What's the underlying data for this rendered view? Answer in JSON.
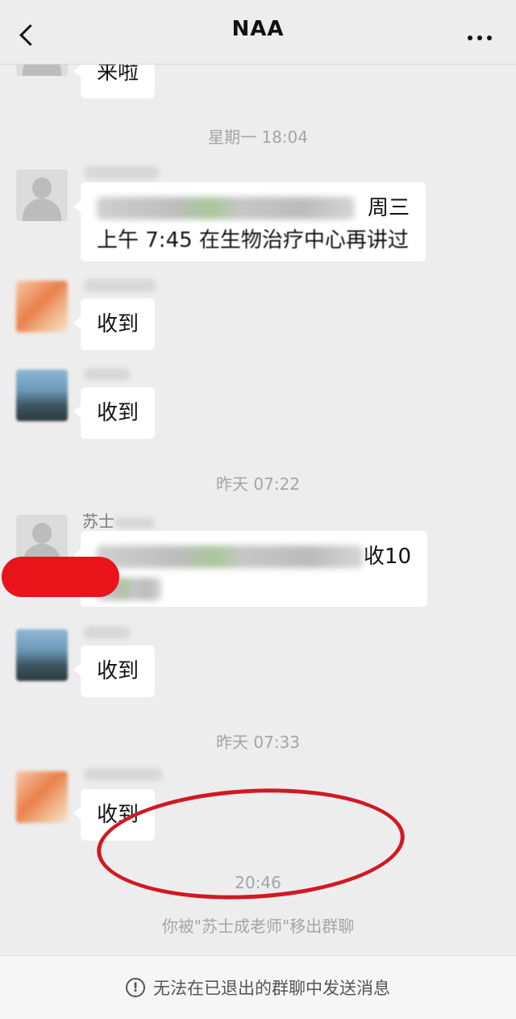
{
  "header": {
    "title": "NAA"
  },
  "messages": {
    "top_partial": "来啦",
    "ts1": "星期一 18:04",
    "msg1_tail": "周三",
    "msg1_line2": "上午 7:45 在生物治疗中心再讲过",
    "reply1": "收到",
    "reply2": "收到",
    "ts2": "昨天 07:22",
    "sender_name": "苏士",
    "msg2_tail": "收10",
    "reply3": "收到",
    "ts3": "昨天 07:33",
    "reply4": "收到"
  },
  "system": {
    "time": "20:46",
    "notice": "你被\"苏士成老师\"移出群聊"
  },
  "footer": {
    "text": "无法在已退出的群聊中发送消息",
    "icon_glyph": "!"
  },
  "colors": {
    "accent_red": "#cf1a22",
    "background": "#ededed"
  }
}
